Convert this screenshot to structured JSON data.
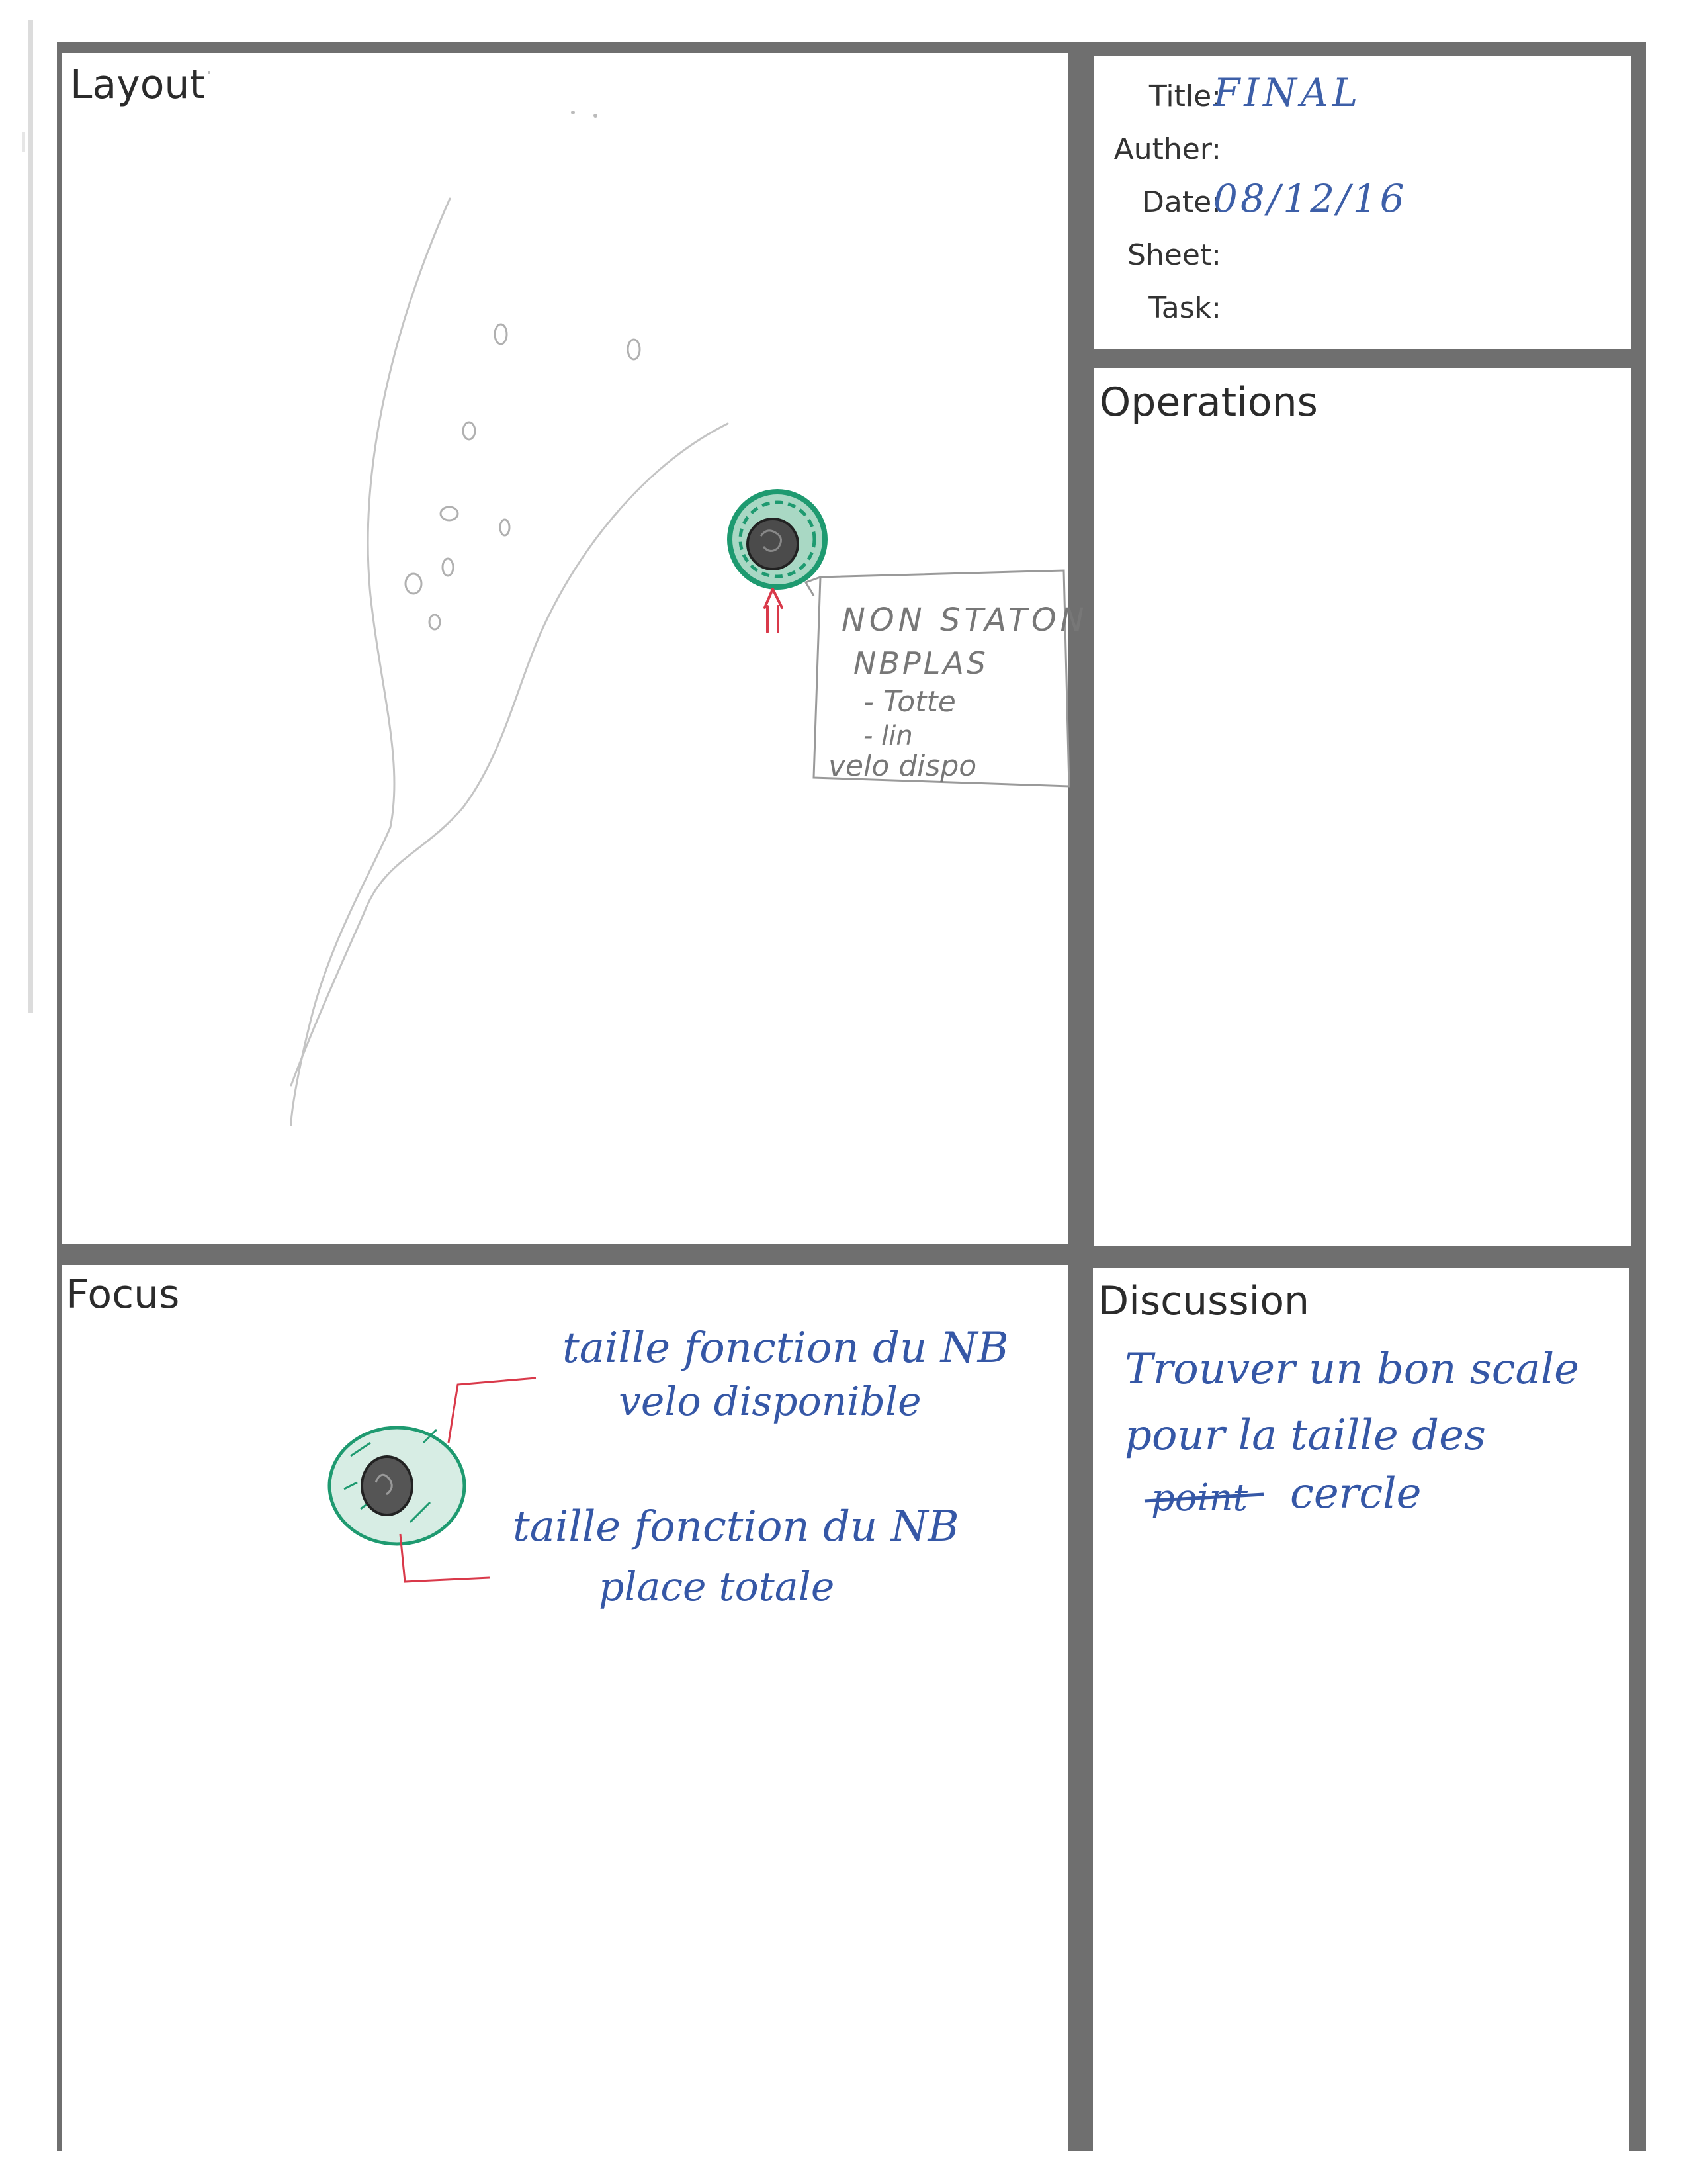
{
  "panels": {
    "layout": "Layout",
    "operations": "Operations",
    "focus": "Focus",
    "discussion": "Discussion"
  },
  "meta": {
    "title_label": "Title:",
    "title_value": "FINAL",
    "author_label": "Auther:",
    "author_value": "",
    "date_label": "Date:",
    "date_value": "08/12/16",
    "sheet_label": "Sheet:",
    "task_label": "Task:"
  },
  "layout_sketch": {
    "note_lines": [
      "NON STATON",
      "NBPLAS",
      "- Totte",
      "- lin",
      "velo dispo"
    ]
  },
  "focus_sketch": {
    "note_top": [
      "taille fonction du NB",
      "velo disponible"
    ],
    "note_bottom": [
      "taille fonction du NB",
      "place totale"
    ]
  },
  "discussion_notes": {
    "lines": [
      "Trouver un bon scale",
      "pour la taille des",
      "cercle"
    ],
    "struck_word": "point"
  },
  "colors": {
    "frame": "#6f6f6f",
    "ink_blue": "#3557a6",
    "ink_green": "#1e9a70",
    "ink_red": "#d9394a",
    "pencil": "#9a9a9a"
  }
}
